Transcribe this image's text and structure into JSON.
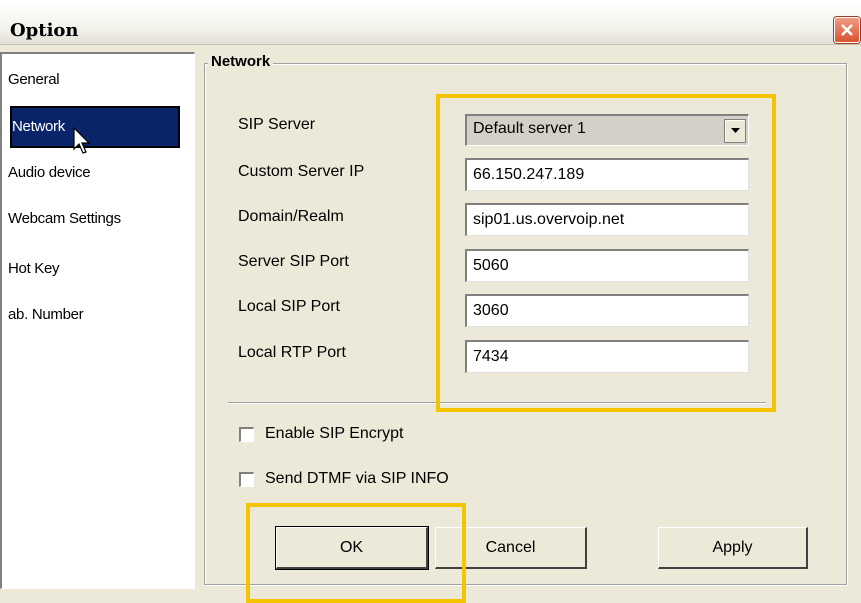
{
  "window": {
    "title": "Option"
  },
  "sidebar": {
    "items": [
      {
        "label": "General"
      },
      {
        "label": "Network"
      },
      {
        "label": "Audio device"
      },
      {
        "label": "Webcam Settings"
      },
      {
        "label": "Hot Key"
      },
      {
        "label": "ab. Number"
      }
    ]
  },
  "network": {
    "group_label": "Network",
    "sip_server": {
      "label": "SIP Server",
      "value": "Default server 1"
    },
    "custom_server_ip": {
      "label": "Custom Server IP",
      "value": "66.150.247.189"
    },
    "domain_realm": {
      "label": "Domain/Realm",
      "value": "sip01.us.overvoip.net"
    },
    "server_sip_port": {
      "label": "Server SIP Port",
      "value": "5060"
    },
    "local_sip_port": {
      "label": "Local SIP Port",
      "value": "3060"
    },
    "local_rtp_port": {
      "label": "Local RTP Port",
      "value": "7434"
    },
    "enable_sip_encrypt": {
      "label": "Enable SIP Encrypt",
      "checked": false
    },
    "send_dtmf": {
      "label": "Send DTMF via SIP INFO",
      "checked": false
    }
  },
  "buttons": {
    "ok": "OK",
    "cancel": "Cancel",
    "apply": "Apply"
  },
  "colors": {
    "highlight": "#f5c400",
    "selection": "#0a246a",
    "close": "#d9532f"
  }
}
